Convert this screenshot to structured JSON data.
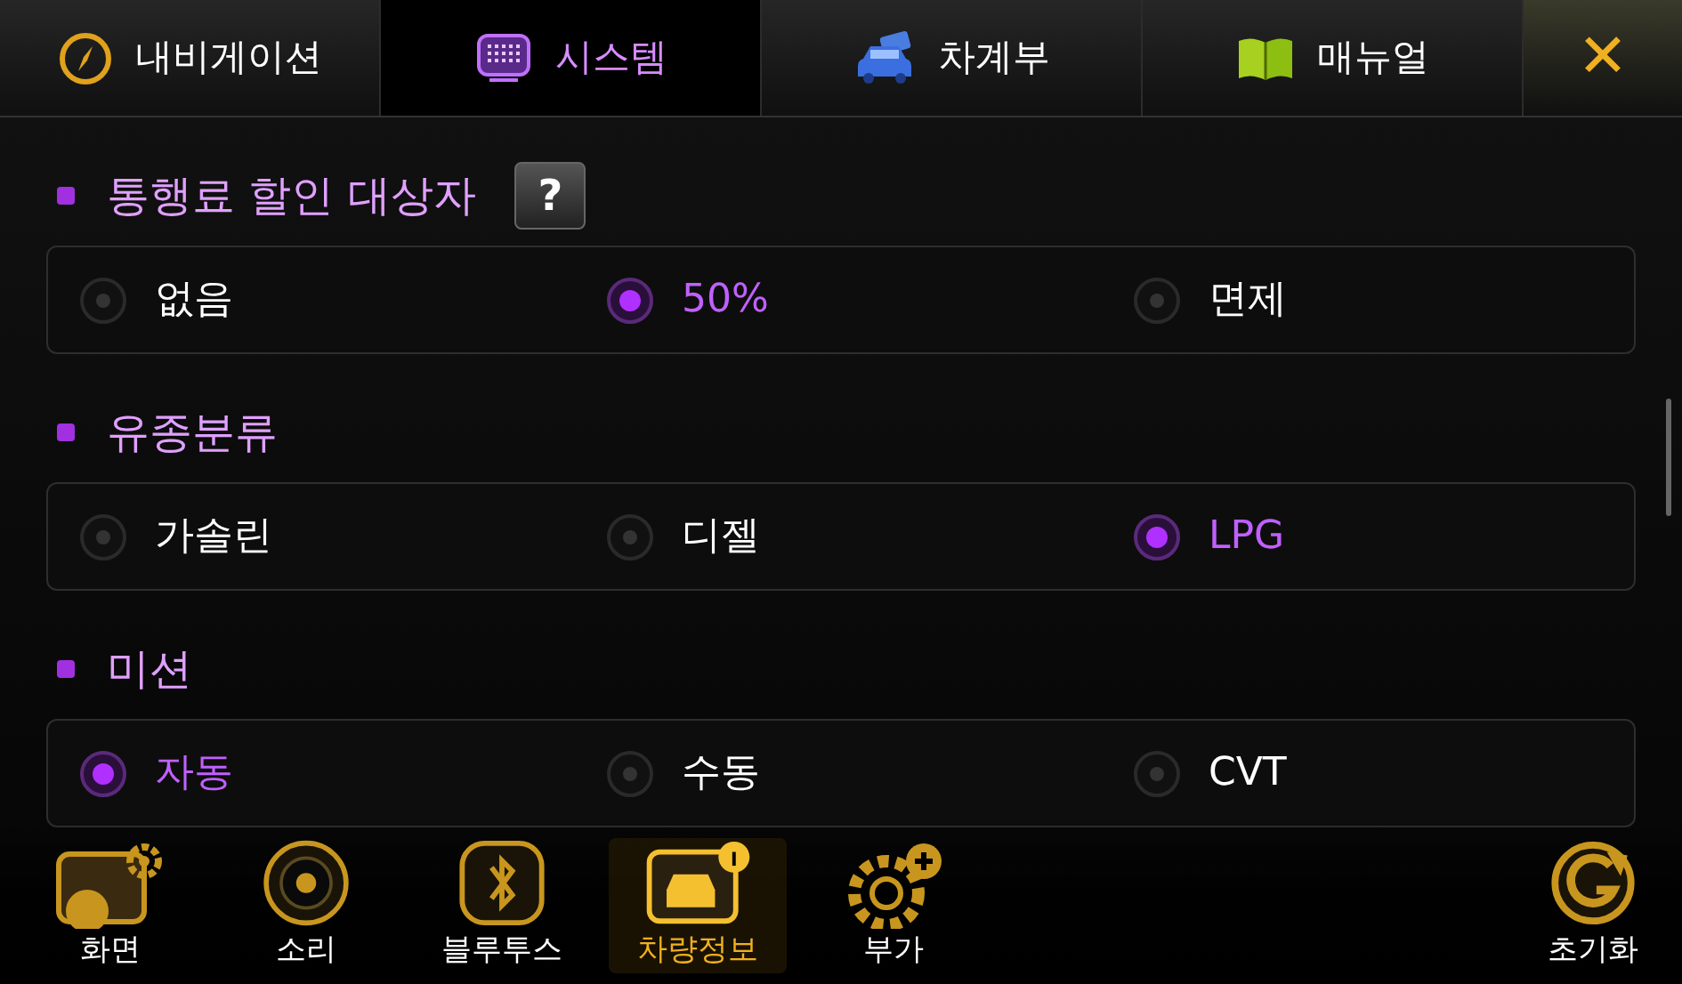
{
  "tabs": [
    {
      "label": "내비게이션",
      "selected": false
    },
    {
      "label": "시스템",
      "selected": true
    },
    {
      "label": "차계부",
      "selected": false
    },
    {
      "label": "매뉴얼",
      "selected": false
    }
  ],
  "close_button": {
    "label": "✕"
  },
  "sections": [
    {
      "title": "통행료 할인 대상자",
      "help": "?",
      "options": [
        {
          "label": "없음",
          "selected": false
        },
        {
          "label": "50%",
          "selected": true
        },
        {
          "label": "면제",
          "selected": false
        }
      ]
    },
    {
      "title": "유종분류",
      "options": [
        {
          "label": "가솔린",
          "selected": false
        },
        {
          "label": "디젤",
          "selected": false
        },
        {
          "label": "LPG",
          "selected": true
        }
      ]
    },
    {
      "title": "미션",
      "options": [
        {
          "label": "자동",
          "selected": true
        },
        {
          "label": "수동",
          "selected": false
        },
        {
          "label": "CVT",
          "selected": false
        }
      ]
    }
  ],
  "dock": [
    {
      "label": "화면",
      "selected": false
    },
    {
      "label": "소리",
      "selected": false
    },
    {
      "label": "블루투스",
      "selected": false
    },
    {
      "label": "차량정보",
      "selected": true
    },
    {
      "label": "부가",
      "selected": false
    }
  ],
  "reset_button": {
    "label": "초기화"
  }
}
